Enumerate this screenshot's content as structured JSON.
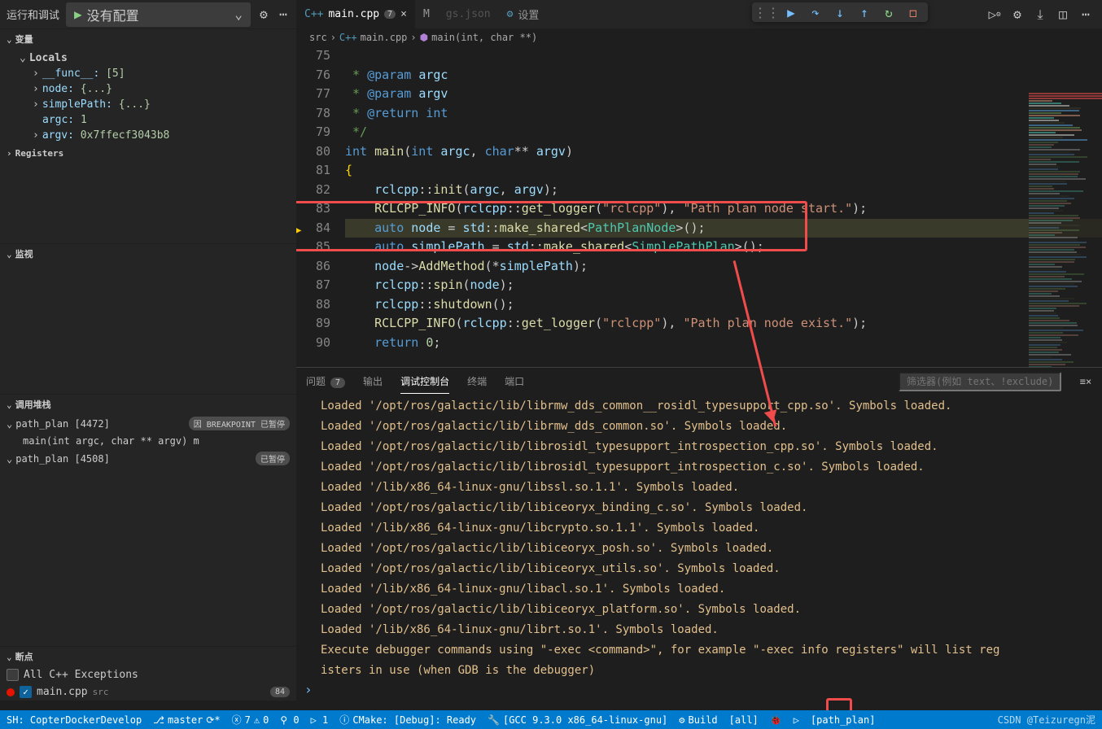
{
  "runDebug": {
    "label": "运行和调试",
    "config": "没有配置"
  },
  "variables": {
    "title": "变量",
    "locals": "Locals",
    "rows": [
      {
        "n": "__func__:",
        "v": "[5]",
        "i": 2,
        "e": true
      },
      {
        "n": "node:",
        "v": "{...}",
        "i": 2,
        "e": true
      },
      {
        "n": "simplePath:",
        "v": "{...}",
        "i": 2,
        "e": true
      },
      {
        "n": "argc:",
        "v": "1",
        "i": 2
      },
      {
        "n": "argv:",
        "v": "0x7ffecf3043b8",
        "i": 2,
        "e": true
      }
    ],
    "registers": "Registers"
  },
  "watch": {
    "title": "监视"
  },
  "callstack": {
    "title": "调用堆栈",
    "rows": [
      {
        "label": "path_plan [4472]",
        "badge": "因 BREAKPOINT 已暂停",
        "e": true
      },
      {
        "label": "main(int argc, char ** argv)  m",
        "frame": true
      },
      {
        "label": "path_plan [4508]",
        "badge": "已暂停",
        "e": true
      }
    ]
  },
  "breakpoints": {
    "title": "断点",
    "rows": [
      {
        "label": "All C++ Exceptions",
        "checked": false
      },
      {
        "label": "main.cpp",
        "sub": "src",
        "checked": true,
        "badge": "84",
        "dot": true
      }
    ]
  },
  "tabs": [
    {
      "label": "main.cpp",
      "icon": "C++",
      "dirty": "7",
      "active": true
    },
    {
      "label": "M",
      "icon": "",
      "partial": true
    },
    {
      "label": "gs.json",
      "hidden": true
    },
    {
      "label": "设置",
      "icon": "⚙"
    }
  ],
  "breadcrumb": {
    "src": "src",
    "file": "main.cpp",
    "fn": "main(int, char **)"
  },
  "code": {
    "start": 75,
    "current": 84,
    "lines": [
      {
        "n": 75,
        "t": ""
      },
      {
        "n": 76,
        "html": "<span class='cm'> * </span><span class='doc'>@param</span><span class='cm'> </span><span class='id'>argc</span>"
      },
      {
        "n": 77,
        "html": "<span class='cm'> * </span><span class='doc'>@param</span><span class='cm'> </span><span class='id'>argv</span>"
      },
      {
        "n": 78,
        "html": "<span class='cm'> * </span><span class='doc'>@return</span><span class='cm'> </span><span class='kw'>int</span>"
      },
      {
        "n": 79,
        "html": "<span class='cm'> */</span>"
      },
      {
        "n": 80,
        "html": "<span class='kw'>int</span> <span class='fn'>main</span>(<span class='kw'>int</span> <span class='id'>argc</span>, <span class='kw'>char</span>** <span class='id'>argv</span>)"
      },
      {
        "n": 81,
        "html": "<span class='br'>{</span>"
      },
      {
        "n": 82,
        "html": "    <span class='id'>rclcpp</span>::<span class='fn'>init</span>(<span class='id'>argc</span>, <span class='id'>argv</span>);"
      },
      {
        "n": 83,
        "html": "    <span class='fn'>RCLCPP_INFO</span>(<span class='id'>rclcpp</span>::<span class='fn'>get_logger</span>(<span class='str'>\"rclcpp\"</span>), <span class='str'>\"Path plan node start.\"</span>);"
      },
      {
        "n": 84,
        "html": "    <span class='kw'>auto</span> <span class='id'>node</span> = <span class='id'>std</span>::<span class='fn'>make_shared</span>&lt;<span class='ty'>PathPlanNode</span>&gt;();",
        "cur": true,
        "bp": true
      },
      {
        "n": 85,
        "html": "    <span class='kw'>auto</span> <span class='id'>simplePath</span> = <span class='id'>std</span>::<span class='fn'>make_shared</span>&lt;<span class='ty'>SimplePathPlan</span>&gt;();"
      },
      {
        "n": 86,
        "html": "    <span class='id'>node</span>-&gt;<span class='fn'>AddMethod</span>(*<span class='id'>simplePath</span>);"
      },
      {
        "n": 87,
        "html": "    <span class='id'>rclcpp</span>::<span class='fn'>spin</span>(<span class='id'>node</span>);"
      },
      {
        "n": 88,
        "html": "    <span class='id'>rclcpp</span>::<span class='fn'>shutdown</span>();"
      },
      {
        "n": 89,
        "html": "    <span class='fn'>RCLCPP_INFO</span>(<span class='id'>rclcpp</span>::<span class='fn'>get_logger</span>(<span class='str'>\"rclcpp\"</span>), <span class='str'>\"Path plan node exist.\"</span>);"
      },
      {
        "n": 90,
        "html": "    <span class='kw'>return</span> <span class='vv'>0</span>;"
      }
    ]
  },
  "panel": {
    "tabs": [
      "问题",
      "输出",
      "调试控制台",
      "终端",
      "端口"
    ],
    "active": 2,
    "problemsBadge": "7",
    "filterPlaceholder": "筛选器(例如 text、!exclude)",
    "lines": [
      "Loaded '/opt/ros/galactic/lib/librmw_dds_common__rosidl_typesupport_cpp.so'. Symbols loaded.",
      "Loaded '/opt/ros/galactic/lib/librmw_dds_common.so'. Symbols loaded.",
      "Loaded '/opt/ros/galactic/lib/librosidl_typesupport_introspection_cpp.so'. Symbols loaded.",
      "Loaded '/opt/ros/galactic/lib/librosidl_typesupport_introspection_c.so'. Symbols loaded.",
      "Loaded '/lib/x86_64-linux-gnu/libssl.so.1.1'. Symbols loaded.",
      "Loaded '/opt/ros/galactic/lib/libiceoryx_binding_c.so'. Symbols loaded.",
      "Loaded '/lib/x86_64-linux-gnu/libcrypto.so.1.1'. Symbols loaded.",
      "Loaded '/opt/ros/galactic/lib/libiceoryx_posh.so'. Symbols loaded.",
      "Loaded '/opt/ros/galactic/lib/libiceoryx_utils.so'. Symbols loaded.",
      "Loaded '/lib/x86_64-linux-gnu/libacl.so.1'. Symbols loaded.",
      "Loaded '/opt/ros/galactic/lib/libiceoryx_platform.so'. Symbols loaded.",
      "Loaded '/lib/x86_64-linux-gnu/librt.so.1'. Symbols loaded.",
      "Execute debugger commands using \"-exec <command>\", for example \"-exec info registers\" will list reg",
      "isters in use (when GDB is the debugger)"
    ]
  },
  "statusbar": {
    "remote": "SH: CopterDockerDevelop",
    "branch": "master",
    "errors": "7",
    "warnings": "0",
    "cmake": "CMake: [Debug]: Ready",
    "kit": "[GCC 9.3.0 x86_64-linux-gnu]",
    "build": "Build",
    "target": "[all]",
    "launch": "[path_plan]",
    "watermark": "CSDN @Teizuregn泥"
  }
}
